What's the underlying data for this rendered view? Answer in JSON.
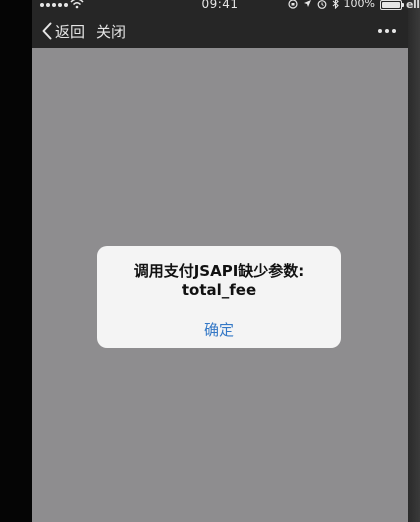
{
  "status_bar": {
    "time": "09:41",
    "battery_percent": "100%",
    "signal_icon": "signal-dots-icon",
    "wifi_icon": "wifi-icon",
    "location_icon": "location-arrow-icon",
    "lock_icon": "rotation-lock-icon",
    "alarm_icon": "alarm-icon",
    "bluetooth_icon": "bluetooth-icon",
    "battery_icon": "battery-icon"
  },
  "nav_bar": {
    "back_label": "返回",
    "close_label": "关闭",
    "more_icon": "more-dots-icon"
  },
  "alert": {
    "message_line1": "调用支付JSAPI缺少参数:",
    "message_line2": "total_fee",
    "confirm_label": "确定"
  },
  "edge_label": "ell",
  "colors": {
    "screen_dim": "#8e8d8f",
    "bars": "#262626",
    "alert_bg": "#f4f4f4",
    "accent": "#3478c6"
  }
}
